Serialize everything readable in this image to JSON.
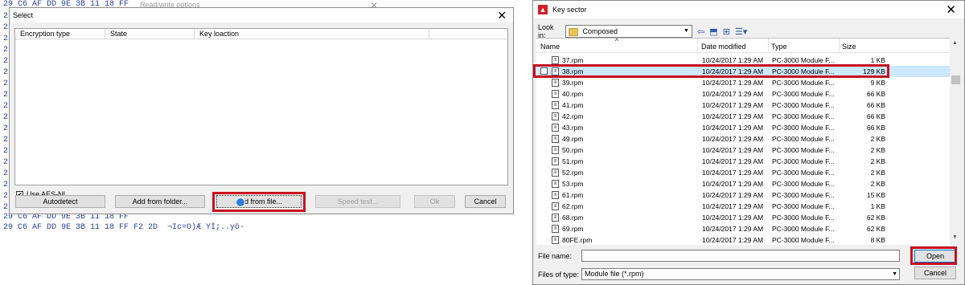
{
  "background": {
    "hex_prefix": [
      "2",
      "2",
      "2",
      "2",
      "2",
      "2",
      "2",
      "2",
      "2",
      "2",
      "2",
      "2",
      "2",
      "2",
      "2",
      "2",
      "2",
      "2"
    ],
    "top_line": "29 C6 AF DD 9E 3B 11 18 FF",
    "rw_title": "Read/write options",
    "mid_line": "29 C6 AF DD 9E 3B 11 18 FF",
    "bottom_line": "29 C6 AF DD 9E 3B 11 18 FF F2 2D  ¬Ic=O)Æ YÌ;..yö-"
  },
  "select_dialog": {
    "title": "Select",
    "columns": [
      "Encryption type",
      "State",
      "Key loaction"
    ],
    "aes_ni_label": "Use AES-NI",
    "aes_ni_checked": true,
    "buttons": {
      "autodetect": "Autodetect",
      "add_from_folder": "Add from folder...",
      "add_from_file": "Add from file...",
      "speed_test": "Speed test...",
      "ok": "Ok",
      "cancel": "Cancel"
    }
  },
  "key_sector_dialog": {
    "title": "Key sector",
    "look_in_label": "Look in:",
    "look_in_value": "Composed",
    "columns": {
      "name": "Name",
      "date": "Date modified",
      "type": "Type",
      "size": "Size"
    },
    "files": [
      {
        "name": "37.rpm",
        "date": "10/24/2017 1:29 AM",
        "type": "PC-3000 Module F...",
        "size": "1 KB"
      },
      {
        "name": "38.rpm",
        "date": "10/24/2017 1:29 AM",
        "type": "PC-3000 Module F...",
        "size": "129 KB"
      },
      {
        "name": "39.rpm",
        "date": "10/24/2017 1:29 AM",
        "type": "PC-3000 Module F...",
        "size": "9 KB"
      },
      {
        "name": "40.rpm",
        "date": "10/24/2017 1:29 AM",
        "type": "PC-3000 Module F...",
        "size": "66 KB"
      },
      {
        "name": "41.rpm",
        "date": "10/24/2017 1:29 AM",
        "type": "PC-3000 Module F...",
        "size": "66 KB"
      },
      {
        "name": "42.rpm",
        "date": "10/24/2017 1:29 AM",
        "type": "PC-3000 Module F...",
        "size": "66 KB"
      },
      {
        "name": "43.rpm",
        "date": "10/24/2017 1:29 AM",
        "type": "PC-3000 Module F...",
        "size": "66 KB"
      },
      {
        "name": "49.rpm",
        "date": "10/24/2017 1:29 AM",
        "type": "PC-3000 Module F...",
        "size": "2 KB"
      },
      {
        "name": "50.rpm",
        "date": "10/24/2017 1:29 AM",
        "type": "PC-3000 Module F...",
        "size": "2 KB"
      },
      {
        "name": "51.rpm",
        "date": "10/24/2017 1:29 AM",
        "type": "PC-3000 Module F...",
        "size": "2 KB"
      },
      {
        "name": "52.rpm",
        "date": "10/24/2017 1:29 AM",
        "type": "PC-3000 Module F...",
        "size": "2 KB"
      },
      {
        "name": "53.rpm",
        "date": "10/24/2017 1:29 AM",
        "type": "PC-3000 Module F...",
        "size": "2 KB"
      },
      {
        "name": "61.rpm",
        "date": "10/24/2017 1:29 AM",
        "type": "PC-3000 Module F...",
        "size": "15 KB"
      },
      {
        "name": "62.rpm",
        "date": "10/24/2017 1:29 AM",
        "type": "PC-3000 Module F...",
        "size": "1 KB"
      },
      {
        "name": "68.rpm",
        "date": "10/24/2017 1:29 AM",
        "type": "PC-3000 Module F...",
        "size": "62 KB"
      },
      {
        "name": "69.rpm",
        "date": "10/24/2017 1:29 AM",
        "type": "PC-3000 Module F...",
        "size": "62 KB"
      },
      {
        "name": "80FE.rpm",
        "date": "10/24/2017 1:29 AM",
        "type": "PC-3000 Module F...",
        "size": "8 KB"
      }
    ],
    "selected_index": 1,
    "file_name_label": "File name:",
    "file_name_value": "",
    "files_of_type_label": "Files of type:",
    "files_of_type_value": "Module file (*.rpm)",
    "open_label": "Open",
    "cancel_label": "Cancel",
    "colors": {
      "highlight": "#c8101e",
      "app_icon": "#d21f26"
    }
  }
}
